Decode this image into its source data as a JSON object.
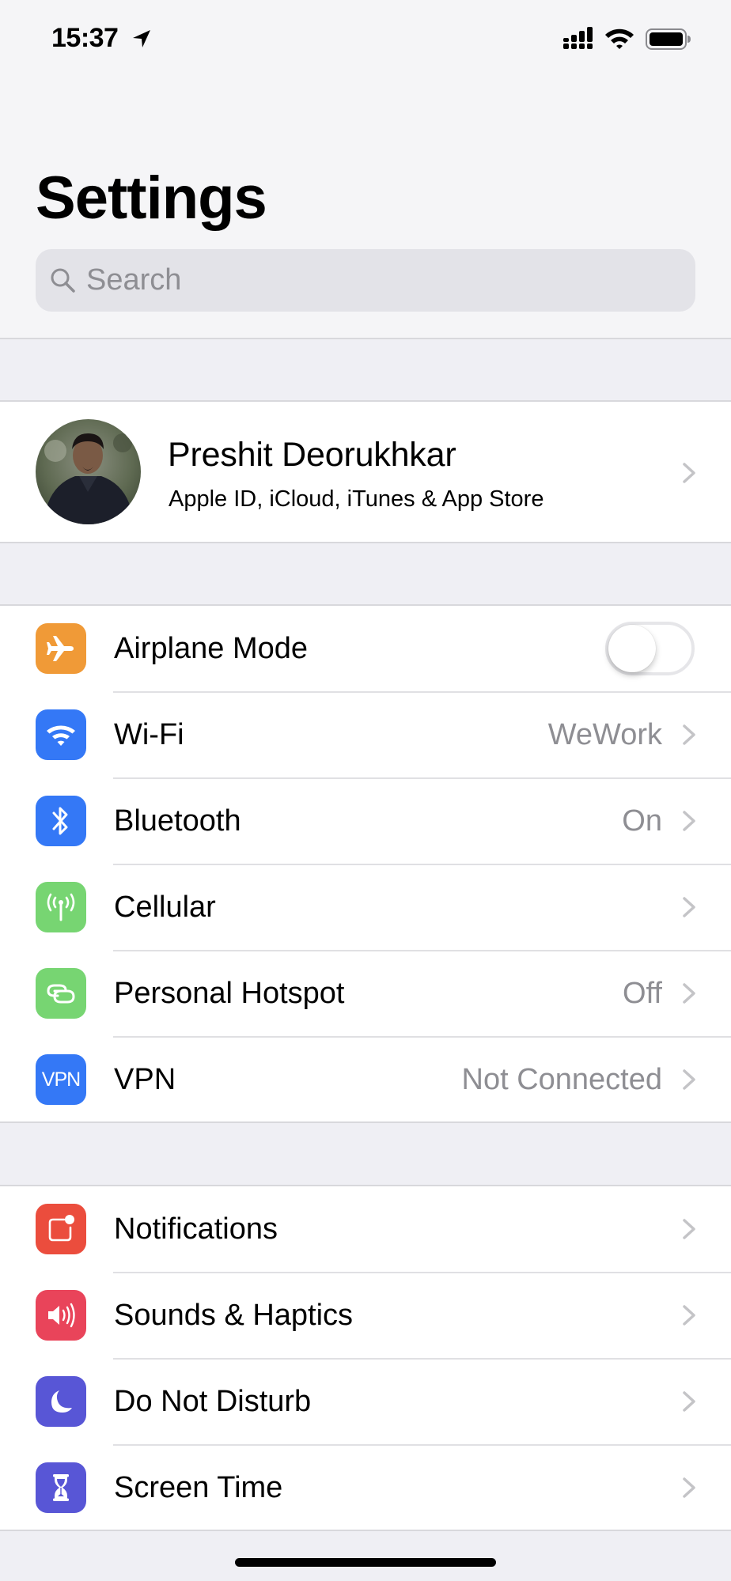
{
  "status_bar": {
    "time": "15:37",
    "location_icon": "location-arrow-icon",
    "signal_icon": "cellular-signal-icon",
    "wifi_icon": "wifi-icon",
    "battery_icon": "battery-full-icon"
  },
  "header": {
    "title": "Settings"
  },
  "search": {
    "placeholder": "Search",
    "value": "",
    "icon": "search-icon"
  },
  "profile": {
    "name": "Preshit Deorukhkar",
    "subtitle": "Apple ID, iCloud, iTunes & App Store",
    "avatar": "avatar-photo"
  },
  "groups": [
    {
      "items": [
        {
          "label": "Airplane Mode",
          "icon": "airplane-icon",
          "icon_color": "#f09a37",
          "control": "toggle",
          "toggle_on": false
        },
        {
          "label": "Wi-Fi",
          "icon": "wifi-icon",
          "icon_color": "#3478f6",
          "value": "WeWork",
          "control": "chevron"
        },
        {
          "label": "Bluetooth",
          "icon": "bluetooth-icon",
          "icon_color": "#3478f6",
          "value": "On",
          "control": "chevron"
        },
        {
          "label": "Cellular",
          "icon": "cellular-antenna-icon",
          "icon_color": "#77d572",
          "value": "",
          "control": "chevron"
        },
        {
          "label": "Personal Hotspot",
          "icon": "hotspot-icon",
          "icon_color": "#77d572",
          "value": "Off",
          "control": "chevron"
        },
        {
          "label": "VPN",
          "icon": "vpn-icon",
          "icon_text": "VPN",
          "icon_color": "#3478f6",
          "value": "Not Connected",
          "control": "chevron"
        }
      ]
    },
    {
      "items": [
        {
          "label": "Notifications",
          "icon": "notifications-icon",
          "icon_color": "#eb4d3d",
          "value": "",
          "control": "chevron"
        },
        {
          "label": "Sounds & Haptics",
          "icon": "speaker-icon",
          "icon_color": "#e9445a",
          "value": "",
          "control": "chevron"
        },
        {
          "label": "Do Not Disturb",
          "icon": "moon-icon",
          "icon_color": "#5856d6",
          "value": "",
          "control": "chevron"
        },
        {
          "label": "Screen Time",
          "icon": "hourglass-icon",
          "icon_color": "#5856d6",
          "value": "",
          "control": "chevron"
        }
      ]
    }
  ],
  "colors": {
    "background": "#efeff4",
    "secondary_text": "#8e8e93",
    "chevron": "#c4c4c7"
  }
}
